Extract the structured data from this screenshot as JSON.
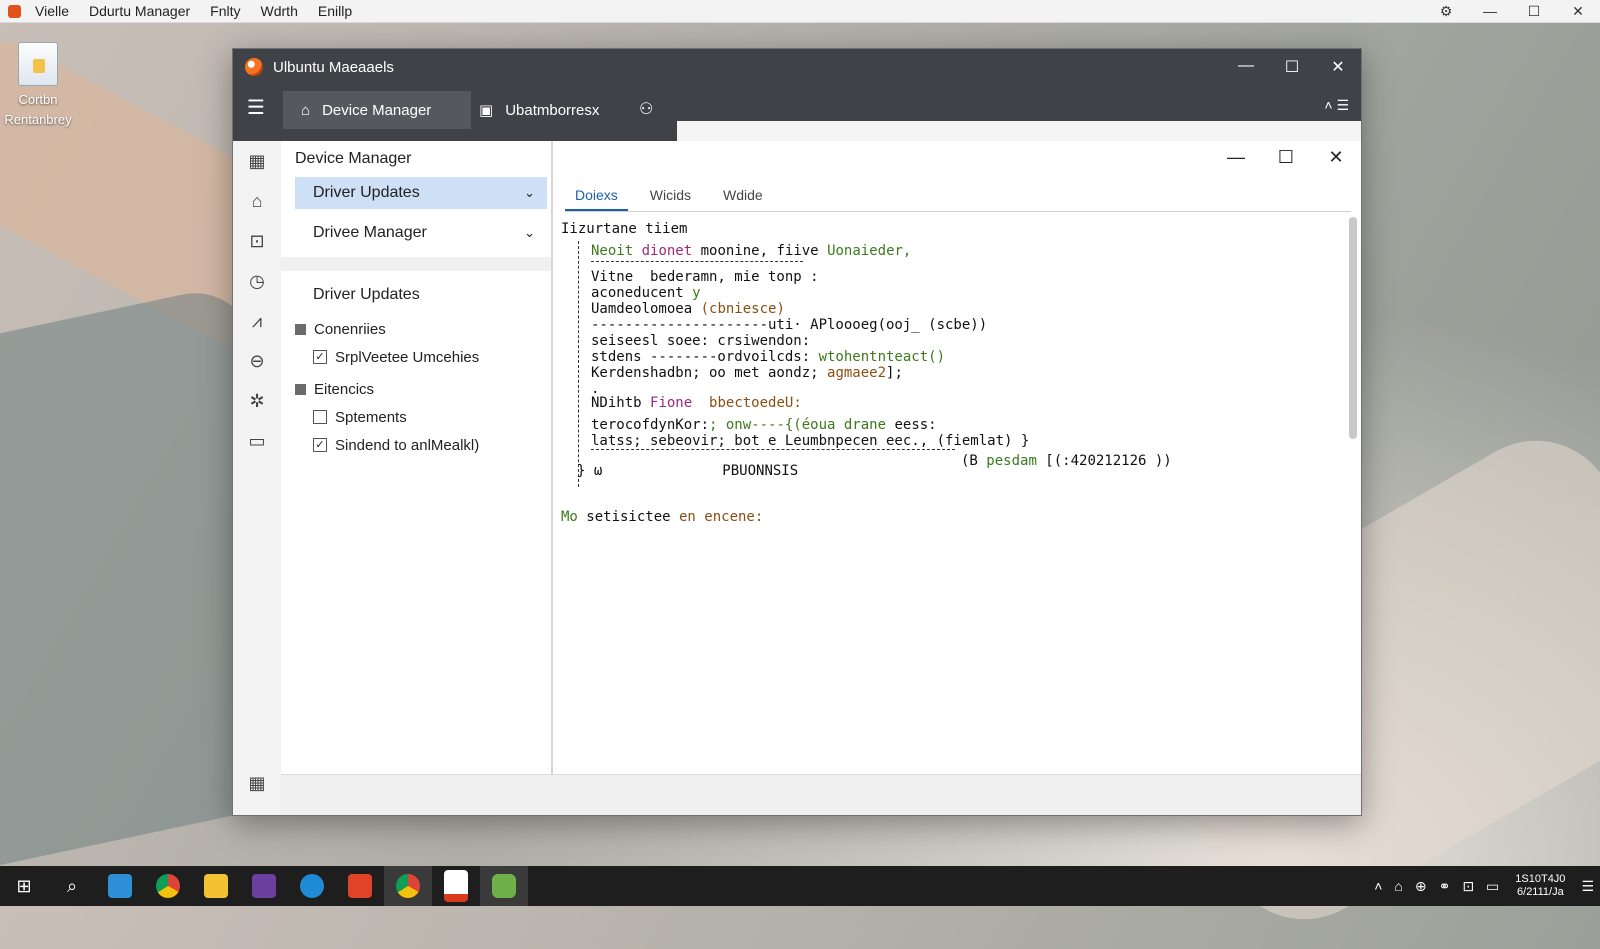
{
  "menubar": {
    "items": [
      "Vielle",
      "Ddurtu Manager",
      "Fnlty",
      "Wdrth",
      "Enillp"
    ]
  },
  "desktop_icon": {
    "label_line1": "Cortbn",
    "label_line2": "Rentanbrey"
  },
  "window": {
    "title": "Ulbuntu Maeaaels",
    "tabs": [
      {
        "label": "Device Manager",
        "icon": "home-icon"
      },
      {
        "label": "Ubatmborresx",
        "icon": "window-icon"
      }
    ]
  },
  "nav": {
    "header": "Device Manager",
    "selected_item": "Driver Updates",
    "second_item": "Drivee Manager",
    "plain_item": "Driver Updates",
    "group1": {
      "label": "Conenriies",
      "checks": [
        {
          "label": "SrplVeetee Umcehies",
          "checked": true
        }
      ]
    },
    "group2": {
      "label": "Eitencics",
      "checks": [
        {
          "label": "Sptements",
          "checked": false
        },
        {
          "label": "Sindend to anlMealkl)",
          "checked": true
        }
      ]
    }
  },
  "content": {
    "tabs": [
      "Doiexs",
      "Wicids",
      "Wdide"
    ],
    "code_title": "Iizurtane tiiem",
    "lines": {
      "l1a": "Neoit",
      "l1b": "dionet",
      "l1c": "moonine, fiive",
      "l1d": "Uonaieder,",
      "l2": "Vitne  bederamn, mie tonp :",
      "l3a": "aconeducent ",
      "l3b": "y",
      "l4a": "Uamdeolomoea",
      "l4b": "(cbniesce)",
      "l5": "---------------------uti· APloooeg(ooj_ (scbe))",
      "l6": "seiseesl soee: crsiwendon:",
      "l7a": "stdens --------ordvoilcds: ",
      "l7b": "wtohentnteact()",
      "l8a": "Kerdenshadbn; oo met aondz; ",
      "l8b": "agmaee2",
      "l8c": "];",
      "l9": ".",
      "l10a": "NDihtb ",
      "l10b": "Fione  ",
      "l10c": "bbectoedeU:",
      "l11a": "terocofdynKor:",
      "l11b": "; onw----{(éoua drane",
      "l11c": " eess:",
      "l12": "latss; sebeovir; bot e Leumbnpecen eec., (fiemlat) }",
      "l13a": "(B ",
      "l13b": "pesdam",
      "l13c": " [(:420212126 ))",
      "l14a": "} ω",
      "l14b": "PBUONNSIS",
      "l15a": "Mo",
      "l15b": " setisictee",
      "l15c": " en encene:"
    }
  },
  "taskbar": {
    "clock_line1": "1S10T4J0",
    "clock_line2": "6/2111/Ja"
  },
  "colors": {
    "titlebar": "#3f4347",
    "accent": "#1e5fa9",
    "selected": "#cde0f5",
    "taskbar": "#1e1e1e"
  }
}
